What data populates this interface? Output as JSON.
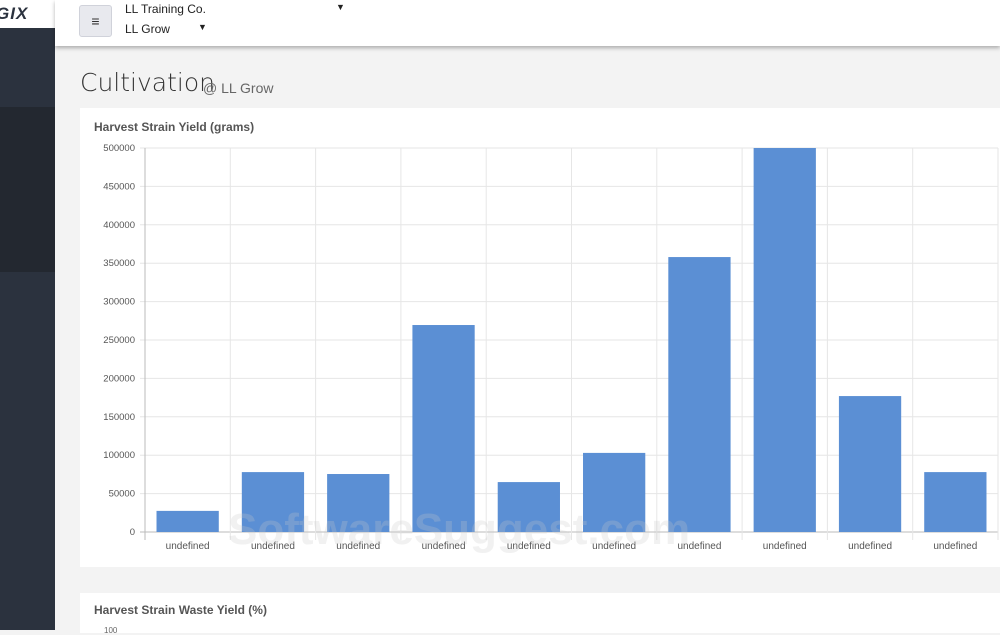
{
  "app": {
    "logo": "GIX"
  },
  "topbar": {
    "menu_icon": "hamburger-icon",
    "organization": "LL Training Co.",
    "location": "LL Grow"
  },
  "page": {
    "title": "Cultivation",
    "subtitle": "@ LL Grow"
  },
  "chart_data": [
    {
      "type": "bar",
      "title": "Harvest Strain Yield (grams)",
      "categories": [
        "undefined",
        "undefined",
        "undefined",
        "undefined",
        "undefined",
        "undefined",
        "undefined",
        "undefined",
        "undefined",
        "undefined"
      ],
      "values": [
        27500,
        78000,
        75500,
        269500,
        65000,
        103000,
        358000,
        500000,
        177000,
        78000
      ],
      "ylim": [
        0,
        500000
      ],
      "yticks": [
        0,
        50000,
        100000,
        150000,
        200000,
        250000,
        300000,
        350000,
        400000,
        450000,
        500000
      ],
      "grid": true,
      "color": "#5b8fd4"
    },
    {
      "type": "bar",
      "title": "Harvest Strain Waste Yield (%)",
      "yticks": [
        100
      ]
    }
  ],
  "watermark": "SoftwareSuggest.com"
}
